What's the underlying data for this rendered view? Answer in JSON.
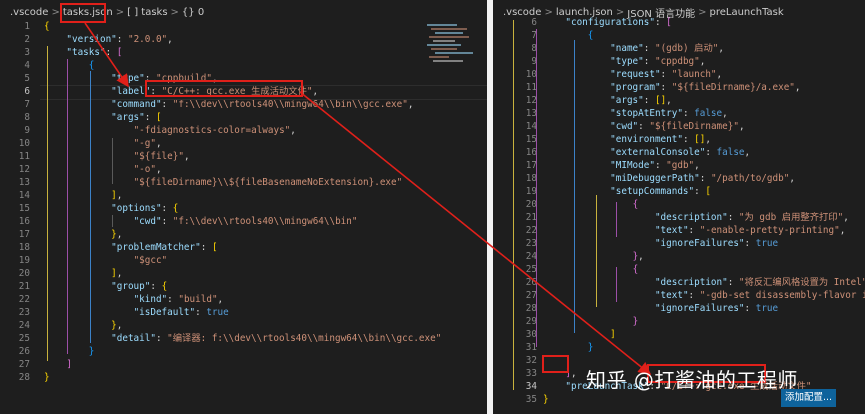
{
  "left": {
    "breadcrumb": [
      ".vscode",
      ">",
      "tasks.json",
      ">",
      "[ ] tasks",
      ">",
      "{} 0"
    ],
    "lines": [
      {
        "n": "1",
        "t": [
          [
            "br1",
            "{"
          ]
        ]
      },
      {
        "n": "2",
        "t": [
          [
            "p",
            "    "
          ],
          [
            "k",
            "\"version\""
          ],
          [
            "p",
            ": "
          ],
          [
            "s",
            "\"2.0.0\""
          ],
          [
            "p",
            ","
          ]
        ]
      },
      {
        "n": "3",
        "t": [
          [
            "p",
            "    "
          ],
          [
            "k",
            "\"tasks\""
          ],
          [
            "p",
            ": "
          ],
          [
            "br2",
            "["
          ]
        ]
      },
      {
        "n": "4",
        "t": [
          [
            "p",
            "        "
          ],
          [
            "br3",
            "{"
          ]
        ]
      },
      {
        "n": "5",
        "t": [
          [
            "p",
            "            "
          ],
          [
            "k",
            "\"type\""
          ],
          [
            "p",
            ": "
          ],
          [
            "s",
            "\"cppbuild\""
          ],
          [
            "p",
            ","
          ]
        ]
      },
      {
        "n": "6",
        "t": [
          [
            "p",
            "            "
          ],
          [
            "k",
            "\"label\""
          ],
          [
            "p",
            ": "
          ],
          [
            "s",
            "\"C/C++: gcc.exe 生成活动文件\""
          ],
          [
            "p",
            ","
          ]
        ]
      },
      {
        "n": "7",
        "t": [
          [
            "p",
            "            "
          ],
          [
            "k",
            "\"command\""
          ],
          [
            "p",
            ": "
          ],
          [
            "s",
            "\"f:\\\\dev\\\\rtools40\\\\mingw64\\\\bin\\\\gcc.exe\""
          ],
          [
            "p",
            ","
          ]
        ]
      },
      {
        "n": "8",
        "t": [
          [
            "p",
            "            "
          ],
          [
            "k",
            "\"args\""
          ],
          [
            "p",
            ": "
          ],
          [
            "br1",
            "["
          ]
        ]
      },
      {
        "n": "9",
        "t": [
          [
            "p",
            "                "
          ],
          [
            "s",
            "\"-fdiagnostics-color=always\""
          ],
          [
            "p",
            ","
          ]
        ]
      },
      {
        "n": "10",
        "t": [
          [
            "p",
            "                "
          ],
          [
            "s",
            "\"-g\""
          ],
          [
            "p",
            ","
          ]
        ]
      },
      {
        "n": "11",
        "t": [
          [
            "p",
            "                "
          ],
          [
            "s",
            "\"${file}\""
          ],
          [
            "p",
            ","
          ]
        ]
      },
      {
        "n": "12",
        "t": [
          [
            "p",
            "                "
          ],
          [
            "s",
            "\"-o\""
          ],
          [
            "p",
            ","
          ]
        ]
      },
      {
        "n": "13",
        "t": [
          [
            "p",
            "                "
          ],
          [
            "s",
            "\"${fileDirname}\\\\${fileBasenameNoExtension}.exe\""
          ]
        ]
      },
      {
        "n": "14",
        "t": [
          [
            "p",
            "            "
          ],
          [
            "br1",
            "]"
          ],
          [
            "p",
            ","
          ]
        ]
      },
      {
        "n": "15",
        "t": [
          [
            "p",
            "            "
          ],
          [
            "k",
            "\"options\""
          ],
          [
            "p",
            ": "
          ],
          [
            "br1",
            "{"
          ]
        ]
      },
      {
        "n": "16",
        "t": [
          [
            "p",
            "                "
          ],
          [
            "k",
            "\"cwd\""
          ],
          [
            "p",
            ": "
          ],
          [
            "s",
            "\"f:\\\\dev\\\\rtools40\\\\mingw64\\\\bin\""
          ]
        ]
      },
      {
        "n": "17",
        "t": [
          [
            "p",
            "            "
          ],
          [
            "br1",
            "}"
          ],
          [
            "p",
            ","
          ]
        ]
      },
      {
        "n": "18",
        "t": [
          [
            "p",
            "            "
          ],
          [
            "k",
            "\"problemMatcher\""
          ],
          [
            "p",
            ": "
          ],
          [
            "br1",
            "["
          ]
        ]
      },
      {
        "n": "19",
        "t": [
          [
            "p",
            "                "
          ],
          [
            "s",
            "\"$gcc\""
          ]
        ]
      },
      {
        "n": "20",
        "t": [
          [
            "p",
            "            "
          ],
          [
            "br1",
            "]"
          ],
          [
            "p",
            ","
          ]
        ]
      },
      {
        "n": "21",
        "t": [
          [
            "p",
            "            "
          ],
          [
            "k",
            "\"group\""
          ],
          [
            "p",
            ": "
          ],
          [
            "br1",
            "{"
          ]
        ]
      },
      {
        "n": "22",
        "t": [
          [
            "p",
            "                "
          ],
          [
            "k",
            "\"kind\""
          ],
          [
            "p",
            ": "
          ],
          [
            "s",
            "\"build\""
          ],
          [
            "p",
            ","
          ]
        ]
      },
      {
        "n": "23",
        "t": [
          [
            "p",
            "                "
          ],
          [
            "k",
            "\"isDefault\""
          ],
          [
            "p",
            ": "
          ],
          [
            "b",
            "true"
          ]
        ]
      },
      {
        "n": "24",
        "t": [
          [
            "p",
            "            "
          ],
          [
            "br1",
            "}"
          ],
          [
            "p",
            ","
          ]
        ]
      },
      {
        "n": "25",
        "t": [
          [
            "p",
            "            "
          ],
          [
            "k",
            "\"detail\""
          ],
          [
            "p",
            ": "
          ],
          [
            "s",
            "\"编译器: f:\\\\dev\\\\rtools40\\\\mingw64\\\\bin\\\\gcc.exe\""
          ]
        ]
      },
      {
        "n": "26",
        "t": [
          [
            "p",
            "        "
          ],
          [
            "br3",
            "}"
          ]
        ]
      },
      {
        "n": "27",
        "t": [
          [
            "p",
            "    "
          ],
          [
            "br2",
            "]"
          ]
        ]
      },
      {
        "n": "28",
        "t": [
          [
            "br1",
            "}"
          ]
        ]
      }
    ]
  },
  "right": {
    "breadcrumb": [
      ".vscode",
      ">",
      "launch.json",
      ">",
      "JSON 语言功能",
      ">",
      "preLaunchTask"
    ],
    "lines": [
      {
        "n": "6",
        "t": [
          [
            "p",
            "    "
          ],
          [
            "k",
            "\"configurations\""
          ],
          [
            "p",
            ": "
          ],
          [
            "br2",
            "["
          ]
        ]
      },
      {
        "n": "7",
        "t": [
          [
            "p",
            "        "
          ],
          [
            "br3",
            "{"
          ]
        ]
      },
      {
        "n": "8",
        "t": [
          [
            "p",
            "            "
          ],
          [
            "k",
            "\"name\""
          ],
          [
            "p",
            ": "
          ],
          [
            "s",
            "\"(gdb) 启动\""
          ],
          [
            "p",
            ","
          ]
        ]
      },
      {
        "n": "9",
        "t": [
          [
            "p",
            "            "
          ],
          [
            "k",
            "\"type\""
          ],
          [
            "p",
            ": "
          ],
          [
            "s",
            "\"cppdbg\""
          ],
          [
            "p",
            ","
          ]
        ]
      },
      {
        "n": "10",
        "t": [
          [
            "p",
            "            "
          ],
          [
            "k",
            "\"request\""
          ],
          [
            "p",
            ": "
          ],
          [
            "s",
            "\"launch\""
          ],
          [
            "p",
            ","
          ]
        ]
      },
      {
        "n": "11",
        "t": [
          [
            "p",
            "            "
          ],
          [
            "k",
            "\"program\""
          ],
          [
            "p",
            ": "
          ],
          [
            "s",
            "\"${fileDirname}/a.exe\""
          ],
          [
            "p",
            ","
          ]
        ]
      },
      {
        "n": "12",
        "t": [
          [
            "p",
            "            "
          ],
          [
            "k",
            "\"args\""
          ],
          [
            "p",
            ": "
          ],
          [
            "br1",
            "[]"
          ],
          [
            "p",
            ","
          ]
        ]
      },
      {
        "n": "13",
        "t": [
          [
            "p",
            "            "
          ],
          [
            "k",
            "\"stopAtEntry\""
          ],
          [
            "p",
            ": "
          ],
          [
            "b",
            "false"
          ],
          [
            "p",
            ","
          ]
        ]
      },
      {
        "n": "14",
        "t": [
          [
            "p",
            "            "
          ],
          [
            "k",
            "\"cwd\""
          ],
          [
            "p",
            ": "
          ],
          [
            "s",
            "\"${fileDirname}\""
          ],
          [
            "p",
            ","
          ]
        ]
      },
      {
        "n": "15",
        "t": [
          [
            "p",
            "            "
          ],
          [
            "k",
            "\"environment\""
          ],
          [
            "p",
            ": "
          ],
          [
            "br1",
            "[]"
          ],
          [
            "p",
            ","
          ]
        ]
      },
      {
        "n": "16",
        "t": [
          [
            "p",
            "            "
          ],
          [
            "k",
            "\"externalConsole\""
          ],
          [
            "p",
            ": "
          ],
          [
            "b",
            "false"
          ],
          [
            "p",
            ","
          ]
        ]
      },
      {
        "n": "17",
        "t": [
          [
            "p",
            "            "
          ],
          [
            "k",
            "\"MIMode\""
          ],
          [
            "p",
            ": "
          ],
          [
            "s",
            "\"gdb\""
          ],
          [
            "p",
            ","
          ]
        ]
      },
      {
        "n": "18",
        "t": [
          [
            "p",
            "            "
          ],
          [
            "k",
            "\"miDebuggerPath\""
          ],
          [
            "p",
            ": "
          ],
          [
            "s",
            "\"/path/to/gdb\""
          ],
          [
            "p",
            ","
          ]
        ]
      },
      {
        "n": "19",
        "t": [
          [
            "p",
            "            "
          ],
          [
            "k",
            "\"setupCommands\""
          ],
          [
            "p",
            ": "
          ],
          [
            "br1",
            "["
          ]
        ]
      },
      {
        "n": "20",
        "t": [
          [
            "p",
            "                "
          ],
          [
            "br2",
            "{"
          ]
        ]
      },
      {
        "n": "21",
        "t": [
          [
            "p",
            "                    "
          ],
          [
            "k",
            "\"description\""
          ],
          [
            "p",
            ": "
          ],
          [
            "s",
            "\"为 gdb 启用整齐打印\""
          ],
          [
            "p",
            ","
          ]
        ]
      },
      {
        "n": "22",
        "t": [
          [
            "p",
            "                    "
          ],
          [
            "k",
            "\"text\""
          ],
          [
            "p",
            ": "
          ],
          [
            "s",
            "\"-enable-pretty-printing\""
          ],
          [
            "p",
            ","
          ]
        ]
      },
      {
        "n": "23",
        "t": [
          [
            "p",
            "                    "
          ],
          [
            "k",
            "\"ignoreFailures\""
          ],
          [
            "p",
            ": "
          ],
          [
            "b",
            "true"
          ]
        ]
      },
      {
        "n": "24",
        "t": [
          [
            "p",
            "                "
          ],
          [
            "br2",
            "}"
          ],
          [
            "p",
            ","
          ]
        ]
      },
      {
        "n": "25",
        "t": [
          [
            "p",
            "                "
          ],
          [
            "br2",
            "{"
          ]
        ]
      },
      {
        "n": "26",
        "t": [
          [
            "p",
            "                    "
          ],
          [
            "k",
            "\"description\""
          ],
          [
            "p",
            ": "
          ],
          [
            "s",
            "\"将反汇编风格设置为 Intel\""
          ],
          [
            "p",
            ","
          ]
        ]
      },
      {
        "n": "27",
        "t": [
          [
            "p",
            "                    "
          ],
          [
            "k",
            "\"text\""
          ],
          [
            "p",
            ": "
          ],
          [
            "s",
            "\"-gdb-set disassembly-flavor inte"
          ]
        ]
      },
      {
        "n": "28",
        "t": [
          [
            "p",
            "                    "
          ],
          [
            "k",
            "\"ignoreFailures\""
          ],
          [
            "p",
            ": "
          ],
          [
            "b",
            "true"
          ]
        ]
      },
      {
        "n": "29",
        "t": [
          [
            "p",
            "                "
          ],
          [
            "br2",
            "}"
          ]
        ]
      },
      {
        "n": "30",
        "t": [
          [
            "p",
            "            "
          ],
          [
            "br1",
            "]"
          ]
        ]
      },
      {
        "n": "31",
        "t": [
          [
            "p",
            "        "
          ],
          [
            "br3",
            "}"
          ]
        ]
      },
      {
        "n": "32",
        "t": [
          [
            "p",
            ""
          ]
        ]
      },
      {
        "n": "33",
        "t": [
          [
            "p",
            "    "
          ],
          [
            "br2",
            "]"
          ],
          [
            "p",
            ","
          ]
        ]
      },
      {
        "n": "34",
        "t": [
          [
            "p",
            "    "
          ],
          [
            "k",
            "\"preLaunchTask\""
          ],
          [
            "p",
            ": "
          ],
          [
            "s",
            "\"C/C++: gcc.exe 生成活动文件\""
          ]
        ]
      },
      {
        "n": "35",
        "t": [
          [
            "br1",
            "}"
          ]
        ]
      }
    ]
  },
  "watermark": "知乎 @打酱油的工程师",
  "add_config_button": "添加配置...",
  "colors": {
    "annotation": "#e0201a",
    "button": "#0e639c"
  }
}
